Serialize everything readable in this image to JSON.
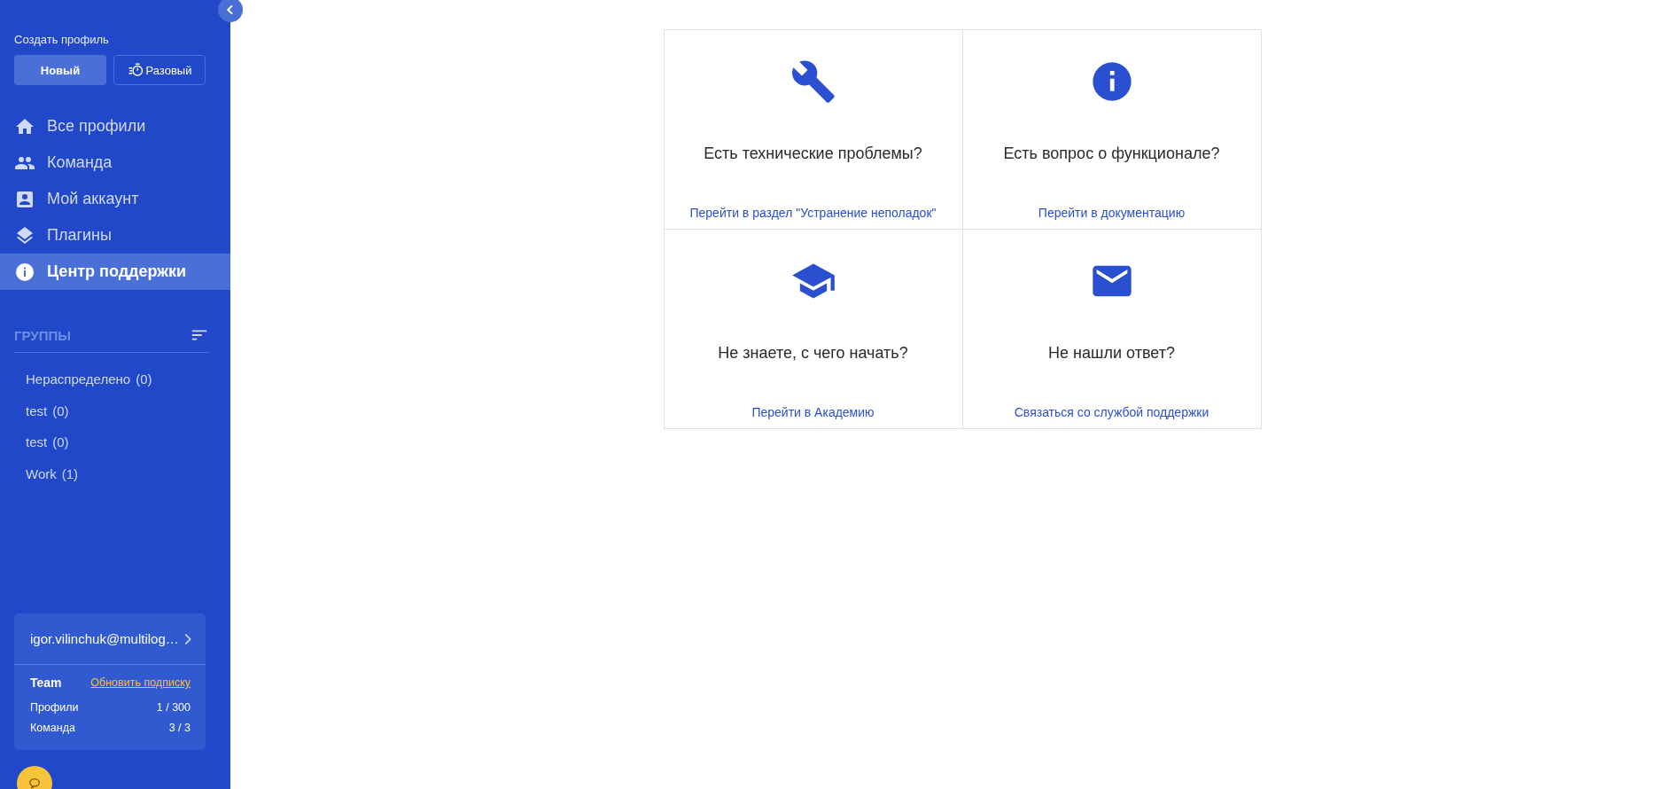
{
  "sidebar": {
    "create_label": "Создать профиль",
    "create_buttons": [
      {
        "label": "Новый",
        "kind": "new"
      },
      {
        "label": "Разовый",
        "kind": "oneoff"
      }
    ],
    "nav": [
      {
        "label": "Все профили",
        "kind": "home",
        "selected": false
      },
      {
        "label": "Команда",
        "kind": "people",
        "selected": false
      },
      {
        "label": "Мой аккаунт",
        "kind": "account",
        "selected": false
      },
      {
        "label": "Плагины",
        "kind": "layers",
        "selected": false
      },
      {
        "label": "Центр поддержки",
        "kind": "info",
        "selected": true
      }
    ],
    "groups_title": "ГРУППЫ",
    "groups": [
      {
        "name": "Нераспределено",
        "count": "(0)"
      },
      {
        "name": "test",
        "count": "(0)"
      },
      {
        "name": "test",
        "count": "(0)"
      },
      {
        "name": "Work",
        "count": "(1)"
      }
    ],
    "account": {
      "email": "igor.vilinchuk@multilog…",
      "plan": "Team",
      "upgrade_link": "Обновить подписку",
      "stats": [
        {
          "label": "Профили",
          "value": "1 / 300"
        },
        {
          "label": "Команда",
          "value": "3 / 3"
        }
      ]
    }
  },
  "cards": [
    {
      "kind": "wrench",
      "title": "Есть технические проблемы?",
      "link": "Перейти в раздел \"Устранение неполадок\""
    },
    {
      "kind": "info",
      "title": "Есть вопрос о функционале?",
      "link": "Перейти в документацию"
    },
    {
      "kind": "cap",
      "title": "Не знаете, с чего начать?",
      "link": "Перейти в Академию"
    },
    {
      "kind": "mail",
      "title": "Не нашли ответ?",
      "link": "Связаться со службой поддержки"
    }
  ]
}
